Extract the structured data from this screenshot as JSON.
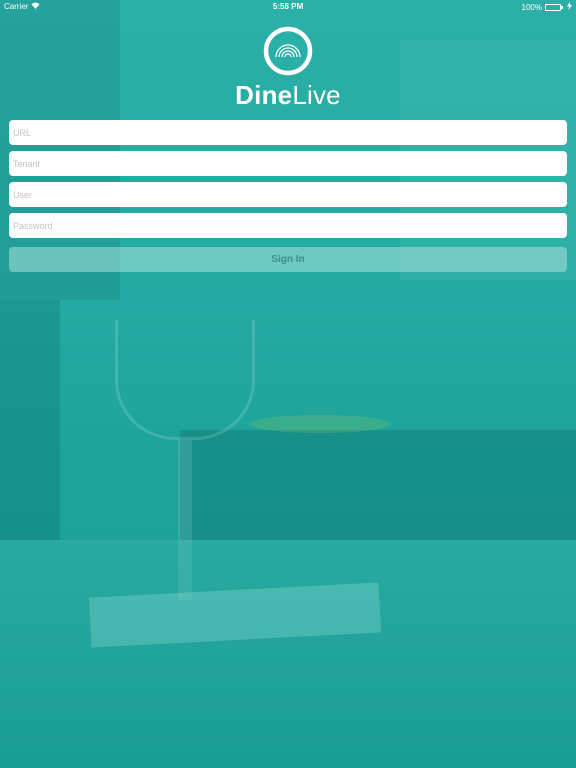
{
  "status_bar": {
    "carrier": "Carrier",
    "time": "5:58 PM",
    "battery": "100%",
    "icons": [
      "wifi-icon",
      "battery-icon",
      "charging-icon"
    ]
  },
  "brand": {
    "name_bold": "Dine",
    "name_light": "Live",
    "logo_icon": "signal-dome-icon"
  },
  "login_form": {
    "url_placeholder": "URL",
    "tenant_placeholder": "Tenant",
    "user_placeholder": "User",
    "password_placeholder": "Password",
    "submit_label": "Sign In"
  },
  "colors": {
    "background": "#1fa7a0",
    "field": "#ffffff",
    "button": "#aae1dc",
    "button_text": "#3d8f8a"
  }
}
